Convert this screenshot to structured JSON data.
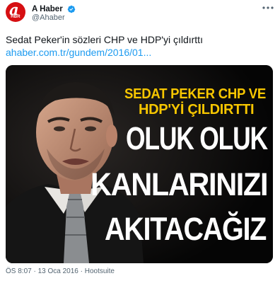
{
  "account": {
    "display_name": "A Haber",
    "handle": "@Ahaber",
    "avatar_letter": "a",
    "avatar_subtext": "HBR",
    "brand_color": "#d60f12",
    "verified_color": "#1d9bf0"
  },
  "tweet": {
    "text": "Sedat Peker'in sözleri CHP ve HDP'yi çıldırttı",
    "link_text": "ahaber.com.tr/gundem/2016/01..."
  },
  "media": {
    "headline_small_1": "SEDAT PEKER CHP VE",
    "headline_small_2": "HDP'Yİ ÇILDIRTTI",
    "headline_big_1": "OLUK OLUK",
    "headline_big_2": "KANLARINIZI",
    "headline_big_3": "AKITACAĞIZ",
    "headline_small_color": "#f7c600",
    "headline_big_color": "#ffffff"
  },
  "footer": {
    "meta": "ÖS 8:07 · 13 Oca 2016 · Hootsuite"
  },
  "icons": {
    "more": "more-icon",
    "verified": "verified-badge-icon"
  }
}
